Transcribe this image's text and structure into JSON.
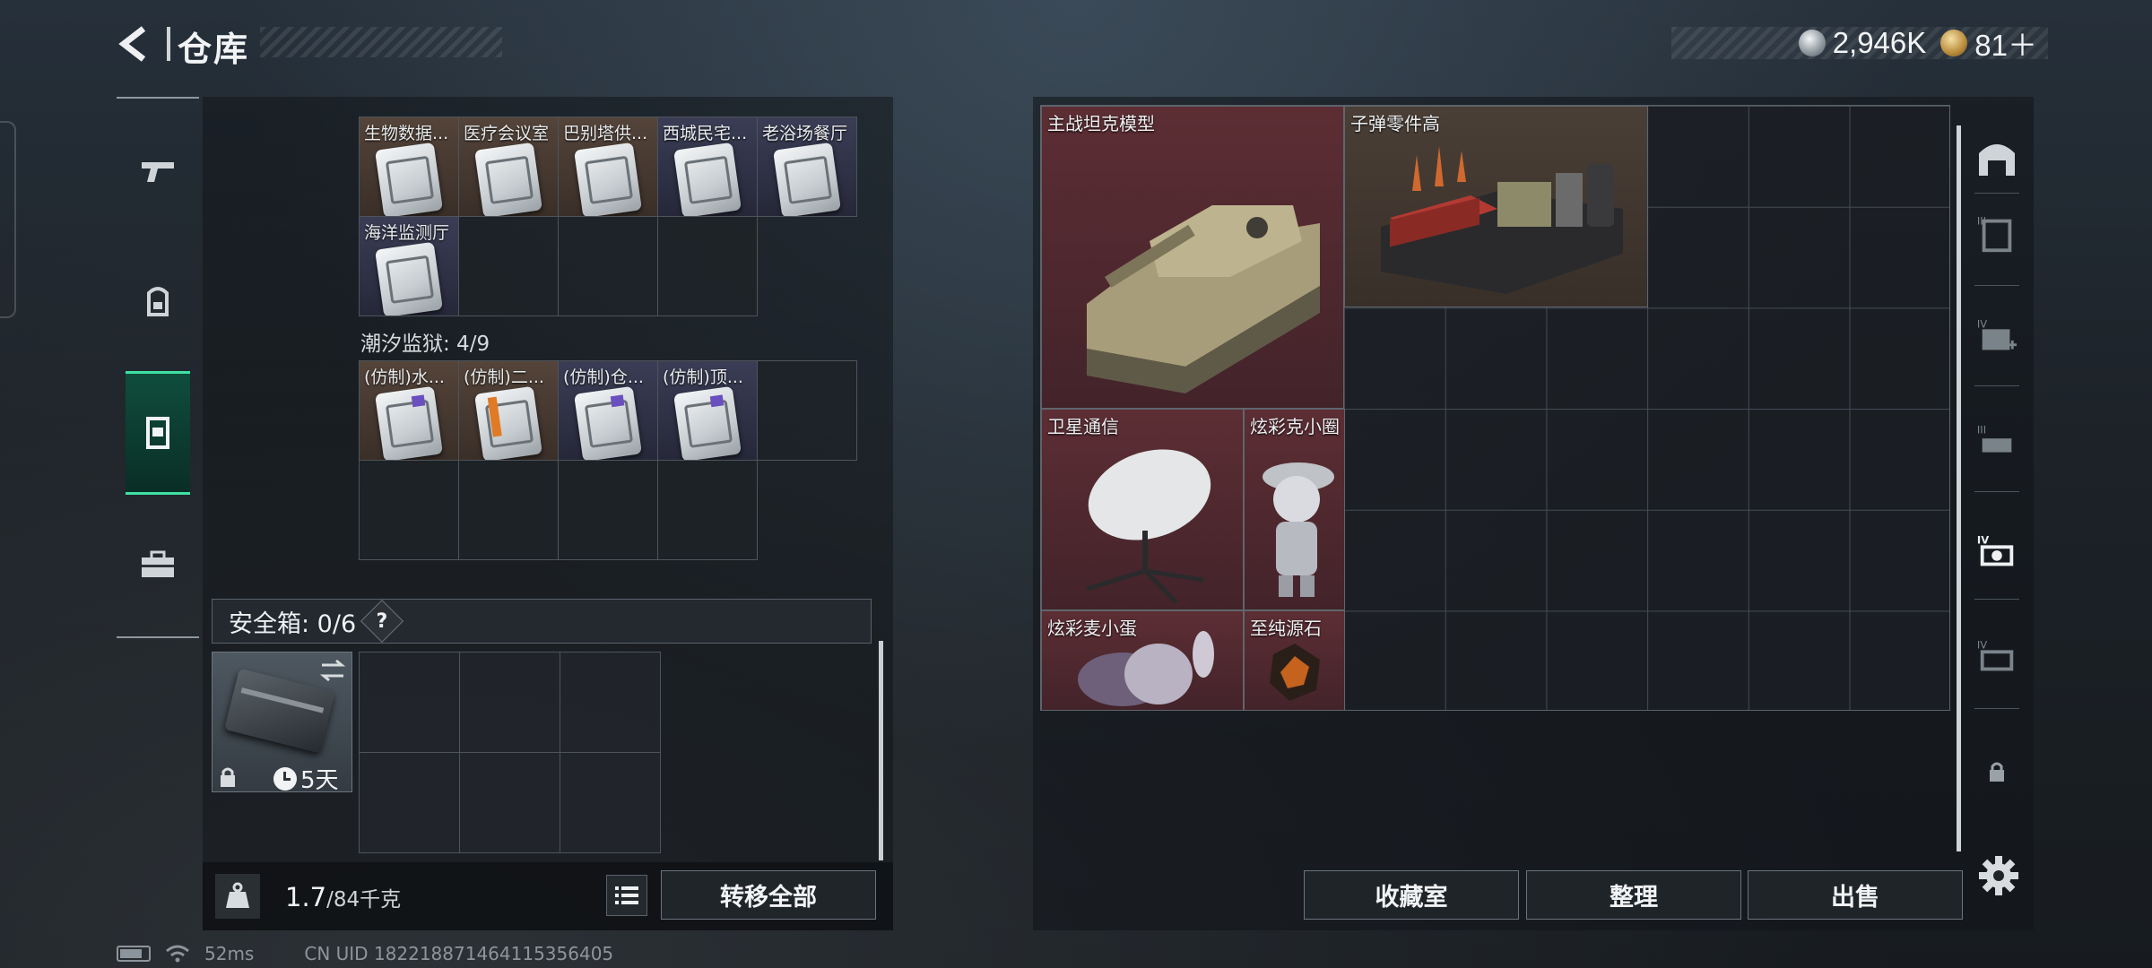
{
  "header": {
    "title": "仓库",
    "currency": [
      {
        "icon": "silver-coin-icon",
        "value": "2,946K"
      },
      {
        "icon": "gold-coin-icon",
        "value": "81＋"
      }
    ]
  },
  "left_tabs": [
    {
      "name": "weapons-tab",
      "icon": "pistol-icon"
    },
    {
      "name": "equipment-tab",
      "icon": "backpack-icon"
    },
    {
      "name": "storage-tab",
      "icon": "locker-icon",
      "active": true
    },
    {
      "name": "supplies-tab",
      "icon": "toolbox-icon"
    }
  ],
  "keycards": {
    "row1": [
      "生物数据...",
      "医疗会议室",
      "巴别塔供...",
      "西城民宅...",
      "老浴场餐厅"
    ],
    "row2": [
      "海洋监测厅"
    ]
  },
  "prison_section": {
    "title": "潮汐监狱: 4/9",
    "cards": [
      "(仿制)水...",
      "(仿制)二...",
      "(仿制)仓...",
      "(仿制)顶..."
    ]
  },
  "safe_box": {
    "title": "安全箱: 0/6",
    "help": "?",
    "timer": "5天"
  },
  "weight": {
    "current": "1.7",
    "capacity": "/84千克"
  },
  "buttons": {
    "transfer_all": "转移全部",
    "collection": "收藏室",
    "organize": "整理",
    "sell": "出售"
  },
  "items": [
    {
      "label": "主战坦克模型",
      "color": "red"
    },
    {
      "label": "子弹零件高",
      "color": "tan"
    },
    {
      "label": "卫星通信",
      "color": "red"
    },
    {
      "label": "炫彩克小圈",
      "color": "red"
    },
    {
      "label": "炫彩麦小蛋",
      "color": "red"
    },
    {
      "label": "至纯源石",
      "color": "red"
    }
  ],
  "status": {
    "ping": "52ms",
    "uid": "CN UID 1822188714641153564​05"
  }
}
